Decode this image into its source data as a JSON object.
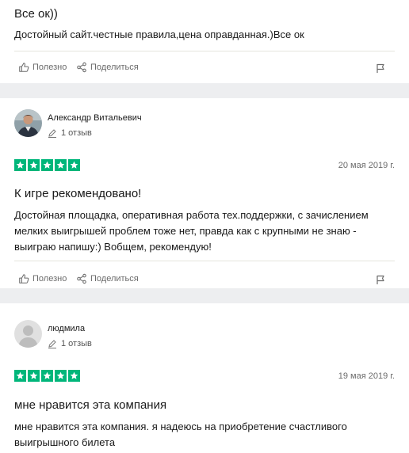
{
  "reviews": [
    {
      "title": "Все ок))",
      "text": "Достойный сайт.честные правила,цена оправданная.)Все ок",
      "actions": {
        "useful": "Полезно",
        "share": "Поделиться"
      }
    },
    {
      "reviewer": {
        "name": "Александр Витальевич",
        "reviews_count": "1 отзыв"
      },
      "rating": 5,
      "date": "20 мая 2019 г.",
      "title": "К игре рекомендовано!",
      "text": "Достойная площадка, оперативная работа тех.поддержки, с зачислением мелких выигрышей проблем тоже нет, правда как с крупными не знаю - выиграю напишу:) Вобщем, рекомендую!",
      "actions": {
        "useful": "Полезно",
        "share": "Поделиться"
      }
    },
    {
      "reviewer": {
        "name": "людмила",
        "reviews_count": "1 отзыв"
      },
      "rating": 5,
      "date": "19 мая 2019 г.",
      "title": "мне нравится эта компания",
      "text": "мне нравится эта компания. я надеюсь на приобретение счастливого выигрышного билета"
    }
  ],
  "colors": {
    "star": "#00b67a",
    "background": "#edeef0"
  }
}
